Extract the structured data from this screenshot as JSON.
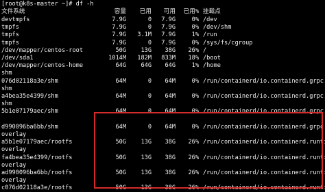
{
  "prompt": "[root@k8s-master ~]# df -h",
  "headers": {
    "filesystem": "文件系统",
    "size": "容量",
    "used": "已用",
    "avail": "可用",
    "use_pct": "已用%",
    "mount": "挂载点"
  },
  "rows": [
    {
      "fs": "devtmpfs",
      "size": "7.9G",
      "used": "0",
      "avail": "7.9G",
      "pct": "0%",
      "mount": "/dev"
    },
    {
      "fs": "tmpfs",
      "size": "7.9G",
      "used": "0",
      "avail": "7.9G",
      "pct": "0%",
      "mount": "/dev/shm"
    },
    {
      "fs": "tmpfs",
      "size": "7.9G",
      "used": "3.1M",
      "avail": "7.9G",
      "pct": "1%",
      "mount": "/run"
    },
    {
      "fs": "tmpfs",
      "size": "7.9G",
      "used": "0",
      "avail": "7.9G",
      "pct": "0%",
      "mount": "/sys/fs/cgroup"
    },
    {
      "fs": "/dev/mapper/centos-root",
      "size": "50G",
      "used": "13G",
      "avail": "38G",
      "pct": "26%",
      "mount": "/"
    },
    {
      "fs": "/dev/sda1",
      "size": "1014M",
      "used": "182M",
      "avail": "833M",
      "pct": "18%",
      "mount": "/boot"
    },
    {
      "fs": "/dev/mapper/centos-home",
      "size": "64G",
      "used": "64G",
      "avail": "64G",
      "pct": "1%",
      "mount": "/home"
    },
    {
      "fs": "shm",
      "size": "",
      "used": "",
      "avail": "",
      "pct": "",
      "mount": ""
    },
    {
      "fs": "076d02118a3e/shm",
      "size": "64M",
      "used": "0",
      "avail": "64M",
      "pct": "0%",
      "mount": "/run/containerd/io.containerd.grpc.v1."
    },
    {
      "fs": "shm",
      "size": "",
      "used": "",
      "avail": "",
      "pct": "",
      "mount": ""
    },
    {
      "fs": "a4bea35e4399/shm",
      "size": "64M",
      "used": "0",
      "avail": "64M",
      "pct": "0%",
      "mount": "/run/containerd/io.containerd.grpc.v1."
    },
    {
      "fs": "shm",
      "size": "",
      "used": "",
      "avail": "",
      "pct": "",
      "mount": ""
    },
    {
      "fs": "5b1e07179aec/shm",
      "size": "64M",
      "used": "0",
      "avail": "64M",
      "pct": "0%",
      "mount": "/run/containerd/io.containerd.grpc.v1."
    },
    {
      "fs": "",
      "size": "",
      "used": "",
      "avail": "",
      "pct": "",
      "mount": ""
    },
    {
      "fs": "d990096ba6bb/shm",
      "size": "64M",
      "used": "0",
      "avail": "64M",
      "pct": "0%",
      "mount": "/run/containerd/io.containerd.grpc.v1."
    },
    {
      "fs": "overlay",
      "size": "",
      "used": "",
      "avail": "",
      "pct": "",
      "mount": ""
    },
    {
      "fs": "a5b1e07179aec/rootfs",
      "size": "50G",
      "used": "13G",
      "avail": "38G",
      "pct": "26%",
      "mount": "/run/containerd/io.containerd.runtime."
    },
    {
      "fs": "overlay",
      "size": "",
      "used": "",
      "avail": "",
      "pct": "",
      "mount": ""
    },
    {
      "fs": "fa4bea35e4399/rootfs",
      "size": "50G",
      "used": "13G",
      "avail": "38G",
      "pct": "26%",
      "mount": "/run/containerd/io.containerd.runtime."
    },
    {
      "fs": "overlay",
      "size": "",
      "used": "",
      "avail": "",
      "pct": "",
      "mount": ""
    },
    {
      "fs": "ad990096ba6bb/rootfs",
      "size": "50G",
      "used": "13G",
      "avail": "38G",
      "pct": "26%",
      "mount": "/run/containerd/io.containerd.runtime."
    },
    {
      "fs": "overlay",
      "size": "",
      "used": "",
      "avail": "",
      "pct": "",
      "mount": ""
    },
    {
      "fs": "c076d02118a3e/rootfs",
      "size": "50G",
      "used": "13G",
      "avail": "38G",
      "pct": "26%",
      "mount": "/run/containerd/io.containerd.runtime."
    }
  ],
  "colors": {
    "background": "#000000",
    "text": "#f2f2f2",
    "highlight": "#d52b2b"
  }
}
